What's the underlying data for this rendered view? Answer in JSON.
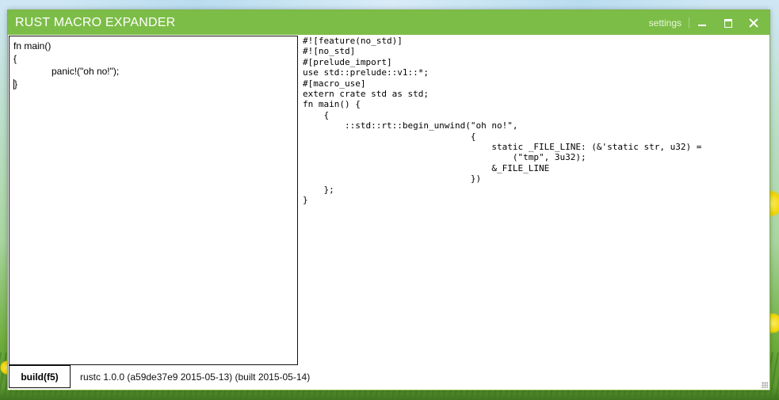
{
  "window": {
    "title": "RUST MACRO EXPANDER",
    "settings_label": "settings",
    "accent_color": "#7cbd47"
  },
  "editor": {
    "lines": [
      "fn main()",
      "{",
      "panic!(\"oh no!\");",
      "}"
    ]
  },
  "output": {
    "text": "#![feature(no_std)]\n#![no_std]\n#[prelude_import]\nuse std::prelude::v1::*;\n#[macro_use]\nextern crate std as std;\nfn main() {\n    {\n        ::std::rt::begin_unwind(\"oh no!\",\n                                {\n                                    static _FILE_LINE: (&'static str, u32) =\n                                        (\"tmp\", 3u32);\n                                    &_FILE_LINE\n                                })\n    };\n}"
  },
  "footer": {
    "build_label": "build(f5)",
    "version_text": "rustc 1.0.0 (a59de37e9 2015-05-13) (built 2015-05-14)"
  },
  "icons": {
    "minimize": "minimize-icon",
    "maximize": "maximize-icon",
    "close": "close-icon",
    "resize": "resize-grip-icon"
  }
}
